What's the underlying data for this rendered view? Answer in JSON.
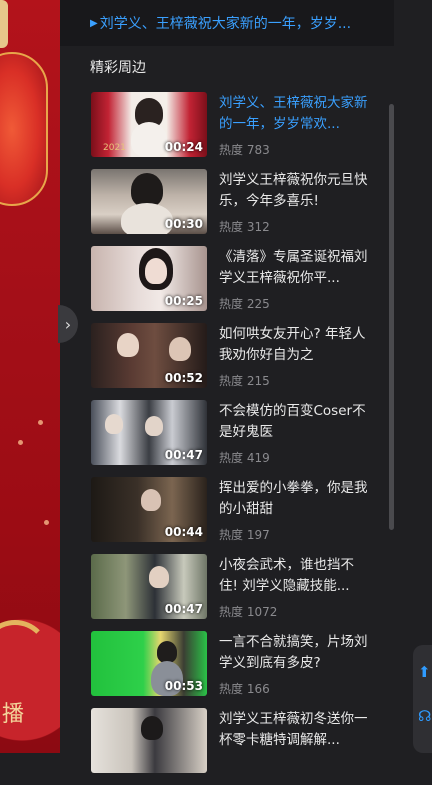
{
  "player": {
    "overlay_char": "播"
  },
  "now_playing": {
    "text": "刘学义、王梓薇祝大家新的一年，岁岁..."
  },
  "section": {
    "title": "精彩周边"
  },
  "items": [
    {
      "title": "刘学义、王梓薇祝大家新的一年，岁岁常欢...",
      "duration": "00:24",
      "heat": "热度 783",
      "active": true
    },
    {
      "title": "刘学义王梓薇祝你元旦快乐，今年多喜乐!",
      "duration": "00:30",
      "heat": "热度 312",
      "active": false
    },
    {
      "title": "《清落》专属圣诞祝福刘学义王梓薇祝你平...",
      "duration": "00:25",
      "heat": "热度 225",
      "active": false
    },
    {
      "title": "如何哄女友开心? 年轻人我劝你好自为之",
      "duration": "00:52",
      "heat": "热度 215",
      "active": false
    },
    {
      "title": "不会模仿的百变Coser不是好鬼医",
      "duration": "00:47",
      "heat": "热度 419",
      "active": false
    },
    {
      "title": "挥出爱的小拳拳，你是我的小甜甜",
      "duration": "00:44",
      "heat": "热度 197",
      "active": false
    },
    {
      "title": "小夜会武术，谁也挡不住! 刘学义隐藏技能...",
      "duration": "00:47",
      "heat": "热度 1072",
      "active": false
    },
    {
      "title": "一言不合就搞笑，片场刘学义到底有多皮?",
      "duration": "00:53",
      "heat": "热度 166",
      "active": false
    },
    {
      "title": "刘学义王梓薇初冬送你一杯零卡糖特调解解...",
      "duration": "",
      "heat": "",
      "active": false
    }
  ],
  "thumb_year": "2021",
  "colors": {
    "accent": "#3aa0ff",
    "panel_bg": "#1f1f22",
    "text": "#e9e9e9",
    "muted": "#8a8a8e"
  },
  "icons": {
    "collapse": "chevron-right-icon",
    "float_1": "arrow-up-icon",
    "float_2": "headset-icon"
  }
}
